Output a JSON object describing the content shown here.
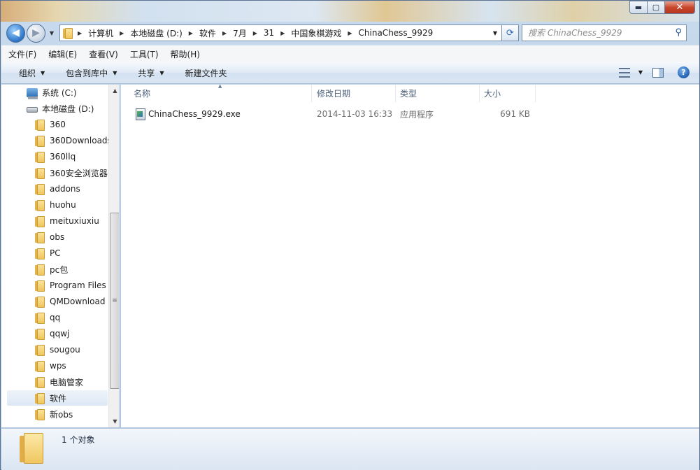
{
  "window": {
    "controls": {
      "minimize": "▬",
      "maximize": "▢",
      "close": "✕"
    }
  },
  "address_bar": {
    "breadcrumbs": [
      "计算机",
      "本地磁盘 (D:)",
      "软件",
      "7月",
      "31",
      "中国象棋游戏",
      "ChinaChess_9929"
    ]
  },
  "search": {
    "placeholder": "搜索 ChinaChess_9929"
  },
  "menu": {
    "file": "文件(F)",
    "edit": "编辑(E)",
    "view": "查看(V)",
    "tools": "工具(T)",
    "help": "帮助(H)"
  },
  "toolbar": {
    "organize": "组织",
    "include_in_library": "包含到库中",
    "share": "共享",
    "new_folder": "新建文件夹"
  },
  "nav_tree": {
    "drives": [
      {
        "label": "系统 (C:)",
        "icon": "system-drive-icon"
      },
      {
        "label": "本地磁盘 (D:)",
        "icon": "local-disk-icon"
      }
    ],
    "folders": [
      {
        "label": "360"
      },
      {
        "label": "360Downloads"
      },
      {
        "label": "360llq"
      },
      {
        "label": "360安全浏览器"
      },
      {
        "label": "addons"
      },
      {
        "label": "huohu"
      },
      {
        "label": "meituxiuxiu"
      },
      {
        "label": "obs"
      },
      {
        "label": "PC"
      },
      {
        "label": "pc包"
      },
      {
        "label": "Program Files"
      },
      {
        "label": "QMDownload"
      },
      {
        "label": "qq"
      },
      {
        "label": "qqwj"
      },
      {
        "label": "sougou"
      },
      {
        "label": "wps"
      },
      {
        "label": "电脑管家"
      },
      {
        "label": "软件",
        "selected": true
      },
      {
        "label": "新obs"
      }
    ]
  },
  "columns": {
    "name": "名称",
    "date": "修改日期",
    "type": "类型",
    "size": "大小"
  },
  "files": [
    {
      "name": "ChinaChess_9929.exe",
      "date": "2014-11-03 16:33",
      "type": "应用程序",
      "size": "691 KB",
      "icon": "exe-file-icon"
    }
  ],
  "status": {
    "count": "1 个对象"
  }
}
